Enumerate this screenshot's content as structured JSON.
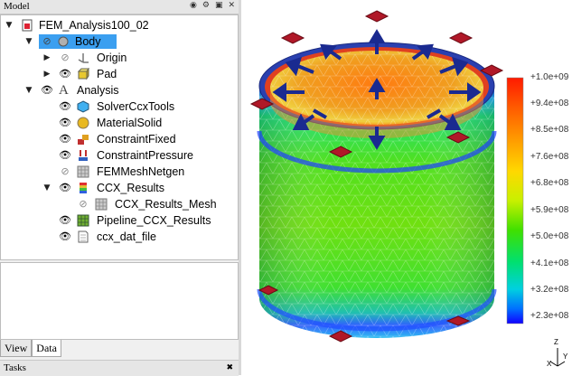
{
  "model_panel": {
    "title": "Model",
    "buttons": [
      "◉",
      "⚙",
      "▣",
      "✕"
    ]
  },
  "tree": [
    {
      "label": "FEM_Analysis100_02",
      "icon": "document-icon"
    },
    {
      "label": "Body",
      "icon": "body-icon",
      "selected": true
    },
    {
      "label": "Origin",
      "icon": "origin-icon"
    },
    {
      "label": "Pad",
      "icon": "pad-icon"
    },
    {
      "label": "Analysis",
      "icon": "analysis-icon"
    },
    {
      "label": "SolverCcxTools",
      "icon": "solver-icon"
    },
    {
      "label": "MaterialSolid",
      "icon": "material-icon"
    },
    {
      "label": "ConstraintFixed",
      "icon": "constraint-fixed-icon"
    },
    {
      "label": "ConstraintPressure",
      "icon": "constraint-pressure-icon"
    },
    {
      "label": "FEMMeshNetgen",
      "icon": "mesh-icon"
    },
    {
      "label": "CCX_Results",
      "icon": "results-icon"
    },
    {
      "label": "CCX_Results_Mesh",
      "icon": "mesh-icon"
    },
    {
      "label": "Pipeline_CCX_Results",
      "icon": "pipeline-icon"
    },
    {
      "label": "ccx_dat_file",
      "icon": "file-icon"
    }
  ],
  "tabs": {
    "view": "View",
    "data": "Data"
  },
  "tasks_panel": {
    "title": "Tasks",
    "close": "✖"
  },
  "legend": {
    "labels": [
      "+1.0e+09",
      "+9.4e+08",
      "+8.5e+08",
      "+7.6e+08",
      "+6.8e+08",
      "+5.9e+08",
      "+5.0e+08",
      "+4.1e+08",
      "+3.2e+08",
      "+2.3e+08"
    ],
    "colors": [
      "#ff1a00",
      "#ff5a00",
      "#ff9a00",
      "#ffd800",
      "#c8f000",
      "#40e000",
      "#00e070",
      "#00d0e0",
      "#0070ff",
      "#1000ff"
    ]
  },
  "axis": {
    "z": "Z",
    "y": "Y",
    "x": "X"
  },
  "colors": {
    "selection": "#3b9ff0"
  }
}
